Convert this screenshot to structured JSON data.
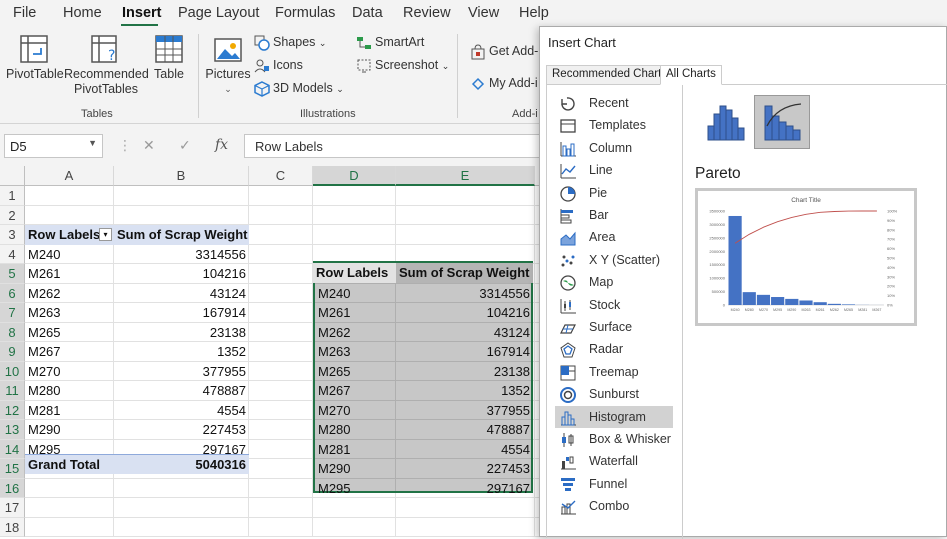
{
  "menu": [
    "File",
    "Home",
    "Insert",
    "Page Layout",
    "Formulas",
    "Data",
    "Review",
    "View",
    "Help"
  ],
  "menu_active": "Insert",
  "ribbon": {
    "pivottable": "PivotTable",
    "recommended1": "Recommended",
    "recommended2": "PivotTables",
    "table": "Table",
    "tables_group": "Tables",
    "pictures": "Pictures",
    "shapes": "Shapes",
    "icons": "Icons",
    "models3d": "3D Models",
    "smartart": "SmartArt",
    "screenshot": "Screenshot",
    "illustrations_group": "Illustrations",
    "get_addins": "Get Add-",
    "my_addins": "My Add-i",
    "addins_group": "Add-i"
  },
  "formula_bar": {
    "name_box": "D5",
    "fx": "fx",
    "content": "Row Labels"
  },
  "columns": [
    "A",
    "B",
    "C",
    "D",
    "E"
  ],
  "rows": [
    "1",
    "2",
    "3",
    "4",
    "5",
    "6",
    "7",
    "8",
    "9",
    "10",
    "11",
    "12",
    "13",
    "14",
    "15",
    "16",
    "17",
    "18"
  ],
  "pivot": {
    "header_label": "Row Labels",
    "header_value": "Sum of Scrap Weight",
    "rows": [
      {
        "label": "M240",
        "value": "3314556"
      },
      {
        "label": "M261",
        "value": "104216"
      },
      {
        "label": "M262",
        "value": "43124"
      },
      {
        "label": "M263",
        "value": "167914"
      },
      {
        "label": "M265",
        "value": "23138"
      },
      {
        "label": "M267",
        "value": "1352"
      },
      {
        "label": "M270",
        "value": "377955"
      },
      {
        "label": "M280",
        "value": "478887"
      },
      {
        "label": "M281",
        "value": "4554"
      },
      {
        "label": "M290",
        "value": "227453"
      },
      {
        "label": "M295",
        "value": "297167"
      }
    ],
    "total_label": "Grand Total",
    "total_value": "5040316"
  },
  "copy_table": {
    "header_label": "Row Labels",
    "header_value": "Sum of Scrap Weight",
    "rows": [
      {
        "label": "M240",
        "value": "3314556"
      },
      {
        "label": "M261",
        "value": "104216"
      },
      {
        "label": "M262",
        "value": "43124"
      },
      {
        "label": "M263",
        "value": "167914"
      },
      {
        "label": "M265",
        "value": "23138"
      },
      {
        "label": "M267",
        "value": "1352"
      },
      {
        "label": "M270",
        "value": "377955"
      },
      {
        "label": "M280",
        "value": "478887"
      },
      {
        "label": "M281",
        "value": "4554"
      },
      {
        "label": "M290",
        "value": "227453"
      },
      {
        "label": "M295",
        "value": "297167"
      }
    ]
  },
  "dialog": {
    "title": "Insert Chart",
    "tab_recommended": "Recommended Charts",
    "tab_all": "All Charts",
    "chart_types": [
      {
        "label": "Recent",
        "icon": "recent-icon"
      },
      {
        "label": "Templates",
        "icon": "templates-icon"
      },
      {
        "label": "Column",
        "icon": "column-chart-icon"
      },
      {
        "label": "Line",
        "icon": "line-chart-icon"
      },
      {
        "label": "Pie",
        "icon": "pie-chart-icon"
      },
      {
        "label": "Bar",
        "icon": "bar-chart-icon"
      },
      {
        "label": "Area",
        "icon": "area-chart-icon"
      },
      {
        "label": "X Y (Scatter)",
        "icon": "scatter-chart-icon"
      },
      {
        "label": "Map",
        "icon": "map-chart-icon"
      },
      {
        "label": "Stock",
        "icon": "stock-chart-icon"
      },
      {
        "label": "Surface",
        "icon": "surface-chart-icon"
      },
      {
        "label": "Radar",
        "icon": "radar-chart-icon"
      },
      {
        "label": "Treemap",
        "icon": "treemap-chart-icon"
      },
      {
        "label": "Sunburst",
        "icon": "sunburst-chart-icon"
      },
      {
        "label": "Histogram",
        "icon": "histogram-chart-icon"
      },
      {
        "label": "Box & Whisker",
        "icon": "box-whisker-chart-icon"
      },
      {
        "label": "Waterfall",
        "icon": "waterfall-chart-icon"
      },
      {
        "label": "Funnel",
        "icon": "funnel-chart-icon"
      },
      {
        "label": "Combo",
        "icon": "combo-chart-icon"
      }
    ],
    "selected_type": "Histogram",
    "selected_subtype_name": "Pareto",
    "preview": {
      "title": "Chart Title",
      "categories": [
        "M240",
        "M280",
        "M270",
        "M295",
        "M290",
        "M263",
        "M261",
        "M262",
        "M265",
        "M281",
        "M267"
      ],
      "values": [
        3314556,
        478887,
        377955,
        297167,
        227453,
        167914,
        104216,
        43124,
        23138,
        4554,
        1352
      ],
      "y_ticks": [
        "3500000",
        "3000000",
        "2500000",
        "2000000",
        "1500000",
        "1000000",
        "500000",
        "0"
      ],
      "y2_ticks": [
        "100%",
        "90%",
        "80%",
        "70%",
        "60%",
        "50%",
        "40%",
        "30%",
        "20%",
        "10%",
        "0%"
      ],
      "ymax": 3500000,
      "bar_color": "#4472c4",
      "line_color": "#c0504d"
    }
  }
}
